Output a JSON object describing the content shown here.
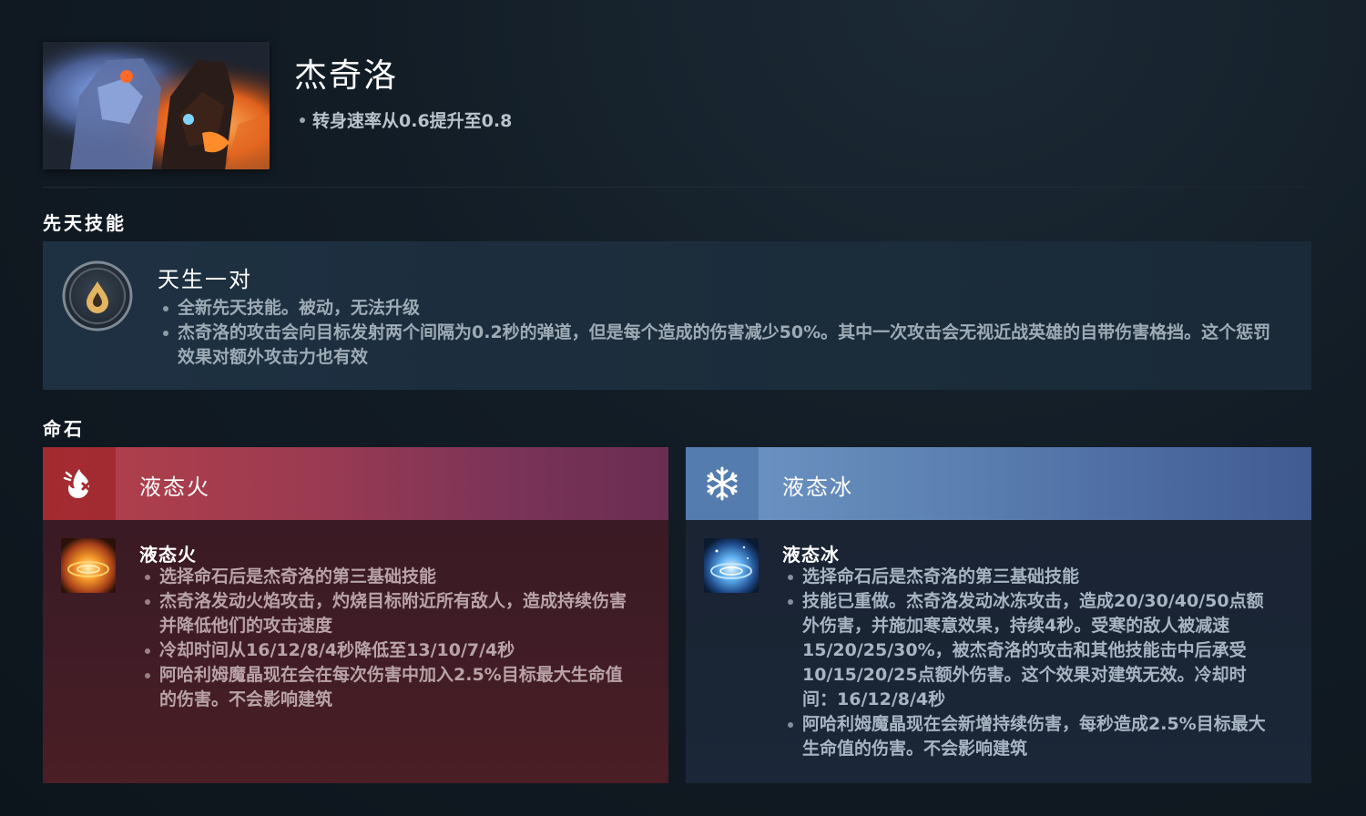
{
  "hero": {
    "name": "杰奇洛",
    "change": "转身速率从0.6提升至0.8"
  },
  "innate": {
    "section_title": "先天技能",
    "name": "天生一对",
    "notes": [
      "全新先天技能。被动，无法升级",
      "杰奇洛的攻击会向目标发射两个间隔为0.2秒的弹道，但是每个造成的伤害减少50%。其中一次攻击会无视近战英雄的自带伤害格挡。这个惩罚效果对额外攻击力也有效"
    ]
  },
  "facets": {
    "section_title": "命石",
    "fire": {
      "title": "液态火",
      "ability_name": "液态火",
      "notes": [
        "选择命石后是杰奇洛的第三基础技能",
        "杰奇洛发动火焰攻击，灼烧目标附近所有敌人，造成持续伤害并降低他们的攻击速度",
        "冷却时间从16/12/8/4秒降低至13/10/7/4秒",
        "阿哈利姆魔晶现在会在每次伤害中加入2.5%目标最大生命值的伤害。不会影响建筑"
      ]
    },
    "ice": {
      "title": "液态冰",
      "ability_name": "液态冰",
      "notes": [
        "选择命石后是杰奇洛的第三基础技能",
        "技能已重做。杰奇洛发动冰冻攻击，造成20/30/40/50点额外伤害，并施加寒意效果，持续4秒。受寒的敌人被减速15/20/25/30%，被杰奇洛的攻击和其他技能击中后承受10/15/20/25点额外伤害。这个效果对建筑无效。冷却时间：16/12/8/4秒",
        "阿哈利姆魔晶现在会新增持续伤害，每秒造成2.5%目标最大生命值的伤害。不会影响建筑"
      ]
    }
  },
  "icons": {
    "innate": "innate-ability-icon",
    "fire_facet": "flame-facet-icon",
    "ice_facet": "snowflake-facet-icon"
  },
  "colors": {
    "fire_header": "#b64048",
    "ice_header": "#6f97c6",
    "innate_panel": "#1e3142"
  }
}
